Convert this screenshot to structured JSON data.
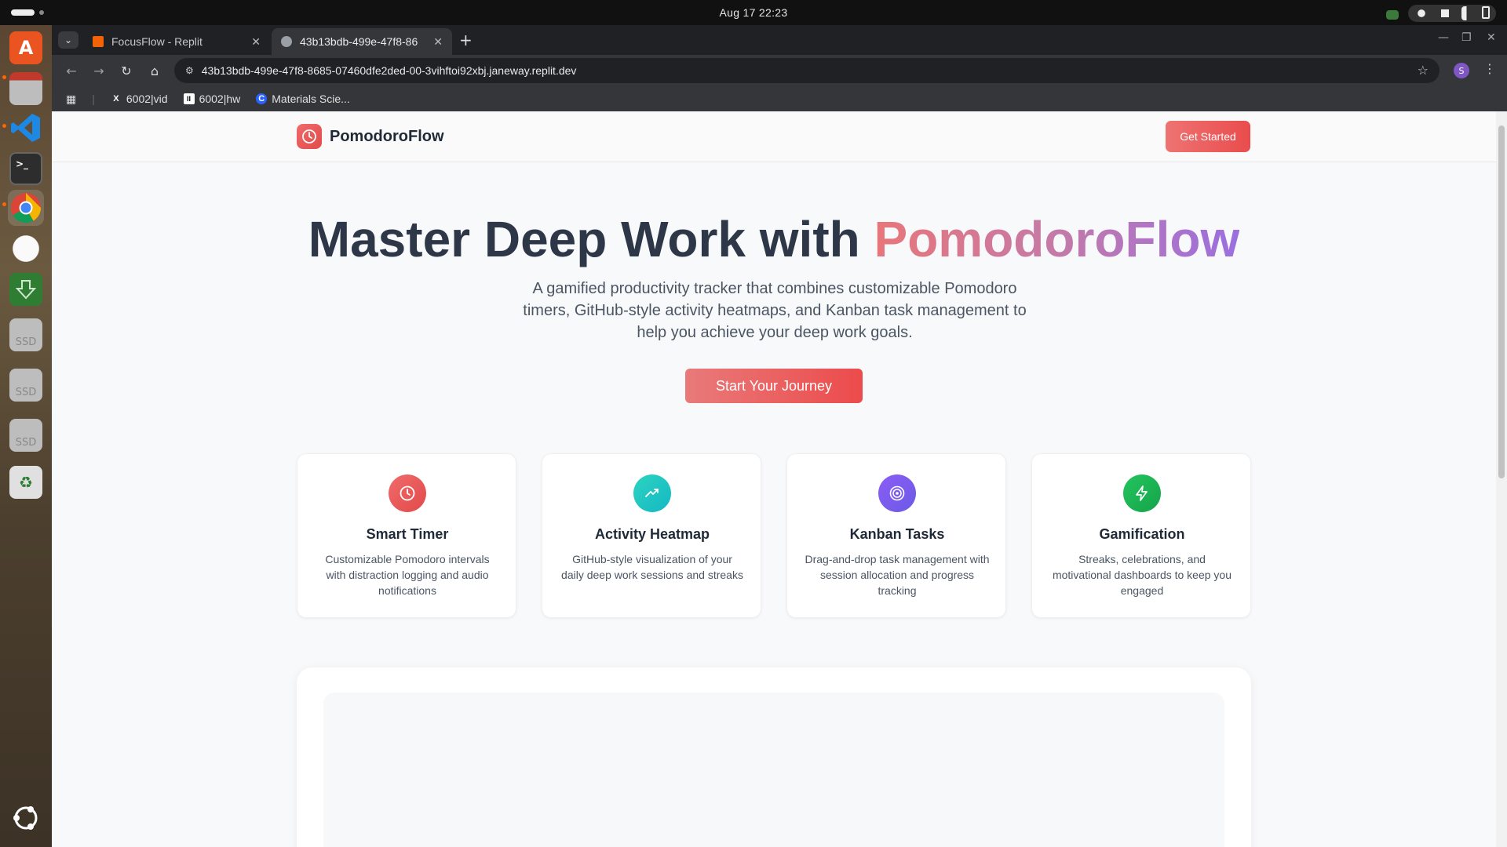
{
  "system": {
    "clock": "Aug 17  22:23"
  },
  "dock": {
    "items": [
      {
        "name": "app-center-icon",
        "color": "#e95420",
        "label": "A"
      },
      {
        "name": "files-icon",
        "color": "#8a8a8a",
        "label": ""
      },
      {
        "name": "vscode-icon",
        "color": "#1e88e5",
        "label": ""
      },
      {
        "name": "terminal-icon",
        "color": "#2d2d2d",
        "label": ">_"
      },
      {
        "name": "chrome-icon",
        "color": "#34a853",
        "label": ""
      },
      {
        "name": "egg-timer-icon",
        "color": "#f2f2f2",
        "label": ""
      },
      {
        "name": "installer-icon",
        "color": "#2e7d32",
        "label": ""
      },
      {
        "name": "ssd-drive-icon",
        "color": "#bdbdbd",
        "label": "SSD"
      },
      {
        "name": "ssd-drive-icon",
        "color": "#bdbdbd",
        "label": "SSD"
      },
      {
        "name": "ssd-drive-icon",
        "color": "#bdbdbd",
        "label": "SSD"
      },
      {
        "name": "trash-icon",
        "color": "#e0e0e0",
        "label": ""
      }
    ]
  },
  "browser": {
    "tabs": [
      {
        "title": "FocusFlow - Replit",
        "icon_color": "#f26207",
        "active": false
      },
      {
        "title": "43b13bdb-499e-47f8-86",
        "icon_color": "#9aa0a6",
        "active": true
      }
    ],
    "url": "43b13bdb-499e-47f8-8685-07460dfe2ded-00-3vihftoi92xbj.janeway.replit.dev",
    "profile_initial": "S",
    "bookmarks": [
      {
        "label": "6002|vid",
        "icon": "X"
      },
      {
        "label": "6002|hw",
        "icon": "II"
      },
      {
        "label": "Materials Scie...",
        "icon": "C"
      }
    ]
  },
  "page": {
    "brand": "PomodoroFlow",
    "get_started": "Get Started",
    "hero_title_main": "Master Deep Work with ",
    "hero_title_accent": "PomodoroFlow",
    "hero_subtitle": "A gamified productivity tracker that combines customizable Pomodoro timers, GitHub-style activity heatmaps, and Kanban task management to help you achieve your deep work goals.",
    "cta": "Start Your Journey",
    "colors": {
      "accent_red": "#e55353",
      "teal": "#14b8c4",
      "purple": "#7c5cf0",
      "green": "#16a34a"
    },
    "features": [
      {
        "icon": "clock-icon",
        "title": "Smart Timer",
        "description": "Customizable Pomodoro intervals with distraction logging and audio notifications"
      },
      {
        "icon": "trending-up-icon",
        "title": "Activity Heatmap",
        "description": "GitHub-style visualization of your daily deep work sessions and streaks"
      },
      {
        "icon": "target-icon",
        "title": "Kanban Tasks",
        "description": "Drag-and-drop task management with session allocation and progress tracking"
      },
      {
        "icon": "lightning-icon",
        "title": "Gamification",
        "description": "Streaks, celebrations, and motivational dashboards to keep you engaged"
      }
    ]
  }
}
